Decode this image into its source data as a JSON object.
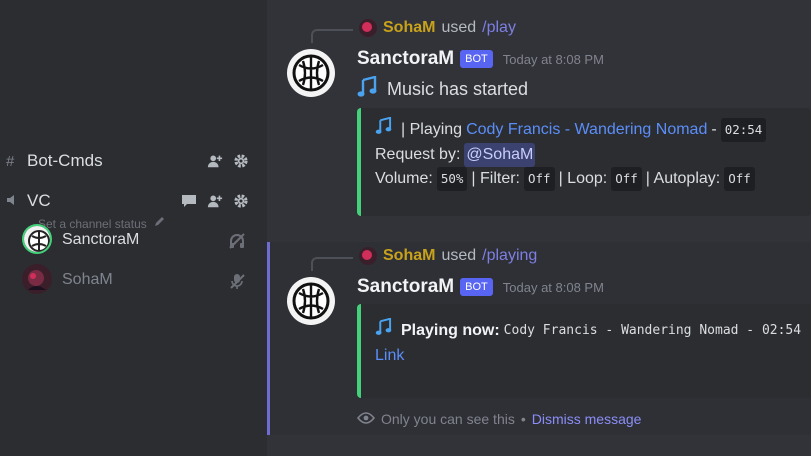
{
  "sidebar": {
    "text_channel": {
      "name": "Bot-Cmds",
      "icon": "hash-icon"
    },
    "voice_channel": {
      "name": "VC",
      "icon": "speaker-icon"
    },
    "status_hint": "Set a channel status",
    "voice_users": [
      {
        "name": "SanctoraM",
        "icon": "muted-off-icon"
      },
      {
        "name": "SohaM",
        "icon": "mic-muted-icon"
      }
    ]
  },
  "messages": [
    {
      "reply_user": "SohaM",
      "reply_verb": "used",
      "reply_command": "/play",
      "author": "SanctoraM",
      "badge": "BOT",
      "timestamp": "Today at 8:08 PM",
      "content": "Music has started",
      "embed": {
        "line1_prefix": "| Playing",
        "track": "Cody Francis - Wandering Nomad",
        "sep": "-",
        "duration": "02:54",
        "request_label": "Request by:",
        "requester": "@SohaM",
        "volume_label": "Volume:",
        "volume": "50%",
        "filter_label": "| Filter:",
        "filter": "Off",
        "loop_label": "| Loop:",
        "loop": "Off",
        "autoplay_label": "| Autoplay:",
        "autoplay": "Off"
      }
    },
    {
      "reply_user": "SohaM",
      "reply_verb": "used",
      "reply_command": "/playing",
      "author": "SanctoraM",
      "badge": "BOT",
      "timestamp": "Today at 8:08 PM",
      "embed": {
        "title": "Playing now:",
        "track_code": "Cody Francis - Wandering Nomad - 02:54",
        "link": "Link"
      },
      "ephemeral": {
        "text": "Only you can see this",
        "bullet": "•",
        "dismiss": "Dismiss message"
      }
    }
  ],
  "colors": {
    "accent": "#5865f2",
    "embed_border": "#43d17a",
    "reply_name": "#c9a21b"
  }
}
